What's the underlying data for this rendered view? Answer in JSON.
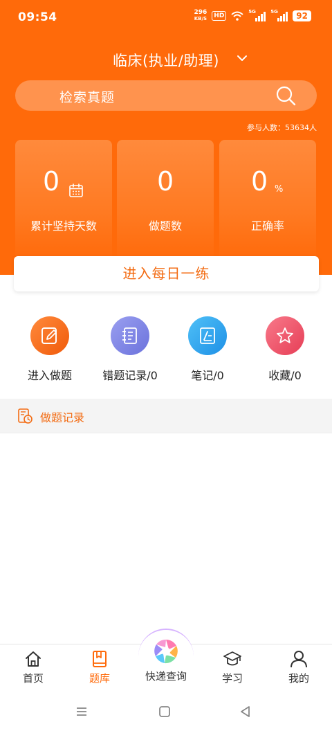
{
  "status_bar": {
    "time": "09:54",
    "net_speed_value": "296",
    "net_speed_unit": "KB/S",
    "hd_label": "HD",
    "signal1_tag": "5G",
    "signal2_tag": "5G",
    "battery": "92"
  },
  "header": {
    "title": "临床(执业/助理)",
    "search_placeholder": "检索真题",
    "participants_label": "参与人数：",
    "participants_count": "53634人"
  },
  "stats": [
    {
      "value": "0",
      "label": "累计坚持天数",
      "icon": "calendar-icon"
    },
    {
      "value": "0",
      "label": "做题数"
    },
    {
      "value": "0",
      "unit": "%",
      "label": "正确率"
    }
  ],
  "daily_practice_label": "进入每日一练",
  "actions": [
    {
      "label": "进入做题",
      "icon": "edit-icon",
      "color": "#f36b12"
    },
    {
      "label": "错题记录/0",
      "icon": "notebook-icon",
      "color": "#7f86e8"
    },
    {
      "label": "笔记/0",
      "icon": "note-icon",
      "color": "#2fa6ef"
    },
    {
      "label": "收藏/0",
      "icon": "star-icon",
      "color": "#ee4f63"
    }
  ],
  "record_section_label": "做题记录",
  "bottom_nav": [
    {
      "label": "首页",
      "icon": "home-icon",
      "active": false
    },
    {
      "label": "题库",
      "icon": "book-icon",
      "active": true
    },
    {
      "label": "快递查询",
      "icon": "aperture-icon",
      "active": false
    },
    {
      "label": "学习",
      "icon": "graduation-cap-icon",
      "active": false
    },
    {
      "label": "我的",
      "icon": "user-icon",
      "active": false
    }
  ],
  "colors": {
    "brand": "#ff6a0a",
    "accent_text": "#f36b12"
  }
}
